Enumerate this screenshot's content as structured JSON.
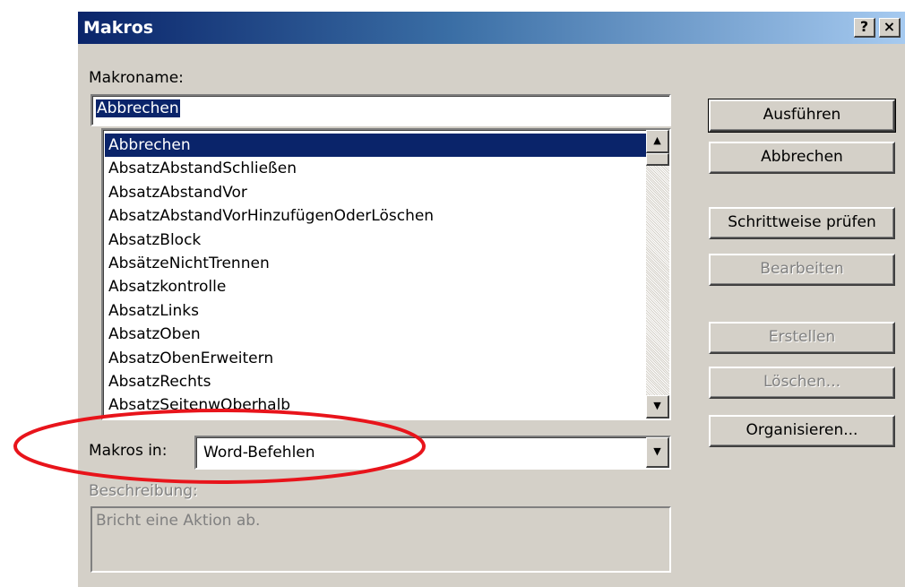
{
  "window": {
    "title": "Makros",
    "help_button": "?",
    "close_button": "×"
  },
  "labels": {
    "macro_name": "Makroname:",
    "macros_in": "Makros in:",
    "description": "Beschreibung:"
  },
  "macro_name_value": "Abbrechen",
  "macro_list": [
    "Abbrechen",
    "AbsatzAbstandSchließen",
    "AbsatzAbstandVor",
    "AbsatzAbstandVorHinzufügenOderLöschen",
    "AbsatzBlock",
    "AbsätzeNichtTrennen",
    "Absatzkontrolle",
    "AbsatzLinks",
    "AbsatzOben",
    "AbsatzObenErweitern",
    "AbsatzRechts",
    "AbsatzSeitenwOberhalb"
  ],
  "selected_index": 0,
  "macros_in_value": "Word-Befehlen",
  "description_text": "Bricht eine Aktion ab.",
  "buttons": {
    "run": "Ausführen",
    "cancel": "Abbrechen",
    "step_into": "Schrittweise prüfen",
    "edit": "Bearbeiten",
    "create": "Erstellen",
    "delete": "Löschen...",
    "organizer": "Organisieren..."
  },
  "colors": {
    "highlight": "#0a246a",
    "annotation": "#e8141b",
    "face": "#d4d0c8"
  },
  "icons": {
    "scroll_up": "triangle-up",
    "scroll_down": "triangle-down",
    "dropdown": "triangle-down"
  }
}
